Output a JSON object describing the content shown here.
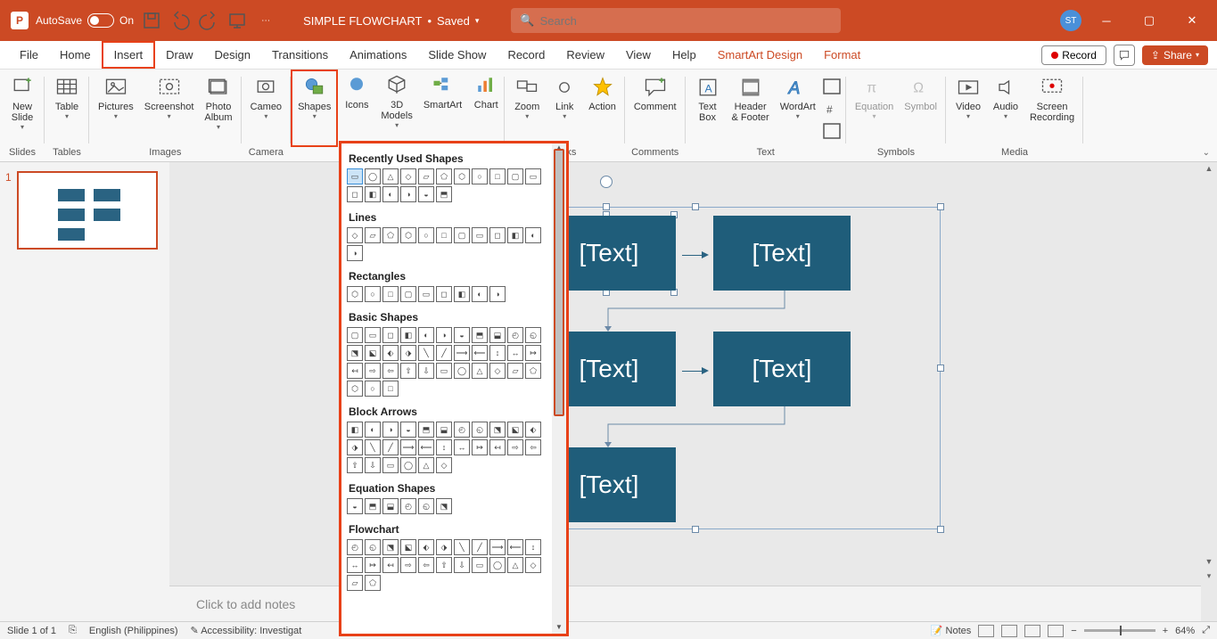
{
  "title_bar": {
    "autosave_label": "AutoSave",
    "autosave_state": "On",
    "doc_title": "SIMPLE FLOWCHART",
    "save_state": "Saved",
    "search_placeholder": "Search",
    "user_initials": "ST"
  },
  "tabs": {
    "file": "File",
    "home": "Home",
    "insert": "Insert",
    "draw": "Draw",
    "design": "Design",
    "transitions": "Transitions",
    "animations": "Animations",
    "slideshow": "Slide Show",
    "record": "Record",
    "review": "Review",
    "view": "View",
    "help": "Help",
    "smartart_design": "SmartArt Design",
    "format": "Format",
    "record_btn": "Record",
    "share_btn": "Share"
  },
  "ribbon": {
    "groups": {
      "slides": {
        "label": "Slides",
        "new_slide": "New\nSlide"
      },
      "tables": {
        "label": "Tables",
        "table": "Table"
      },
      "images": {
        "label": "Images",
        "pictures": "Pictures",
        "screenshot": "Screenshot",
        "photo_album": "Photo\nAlbum"
      },
      "camera": {
        "label": "Camera",
        "cameo": "Cameo"
      },
      "illustrations": {
        "shapes": "Shapes",
        "icons": "Icons",
        "models": "3D\nModels",
        "smartart": "SmartArt",
        "chart": "Chart"
      },
      "links": {
        "label": "Links",
        "zoom": "Zoom",
        "link": "Link",
        "action": "Action"
      },
      "comments": {
        "label": "Comments",
        "comment": "Comment"
      },
      "text": {
        "label": "Text",
        "textbox": "Text\nBox",
        "headerfooter": "Header\n& Footer",
        "wordart": "WordArt"
      },
      "symbols": {
        "label": "Symbols",
        "equation": "Equation",
        "symbol": "Symbol"
      },
      "media": {
        "label": "Media",
        "video": "Video",
        "audio": "Audio",
        "screenrec": "Screen\nRecording"
      }
    }
  },
  "shapes_panel": {
    "categories": [
      {
        "title": "Recently Used Shapes",
        "count": 17
      },
      {
        "title": "Lines",
        "count": 12
      },
      {
        "title": "Rectangles",
        "count": 9
      },
      {
        "title": "Basic Shapes",
        "count": 36
      },
      {
        "title": "Block Arrows",
        "count": 28
      },
      {
        "title": "Equation Shapes",
        "count": 6
      },
      {
        "title": "Flowchart",
        "count": 24
      }
    ]
  },
  "slide": {
    "boxes": {
      "b1": "[Text]",
      "b2": "[Text]",
      "b3": "[Text]",
      "b4": "[Text]",
      "b5": "[Text]"
    },
    "notes_placeholder": "Click to add notes"
  },
  "thumbnails": {
    "slide1_num": "1"
  },
  "status": {
    "slide_info": "Slide 1 of 1",
    "language": "English (Philippines)",
    "accessibility": "Accessibility: Investigat",
    "notes_btn": "Notes",
    "zoom_pct": "64%"
  }
}
